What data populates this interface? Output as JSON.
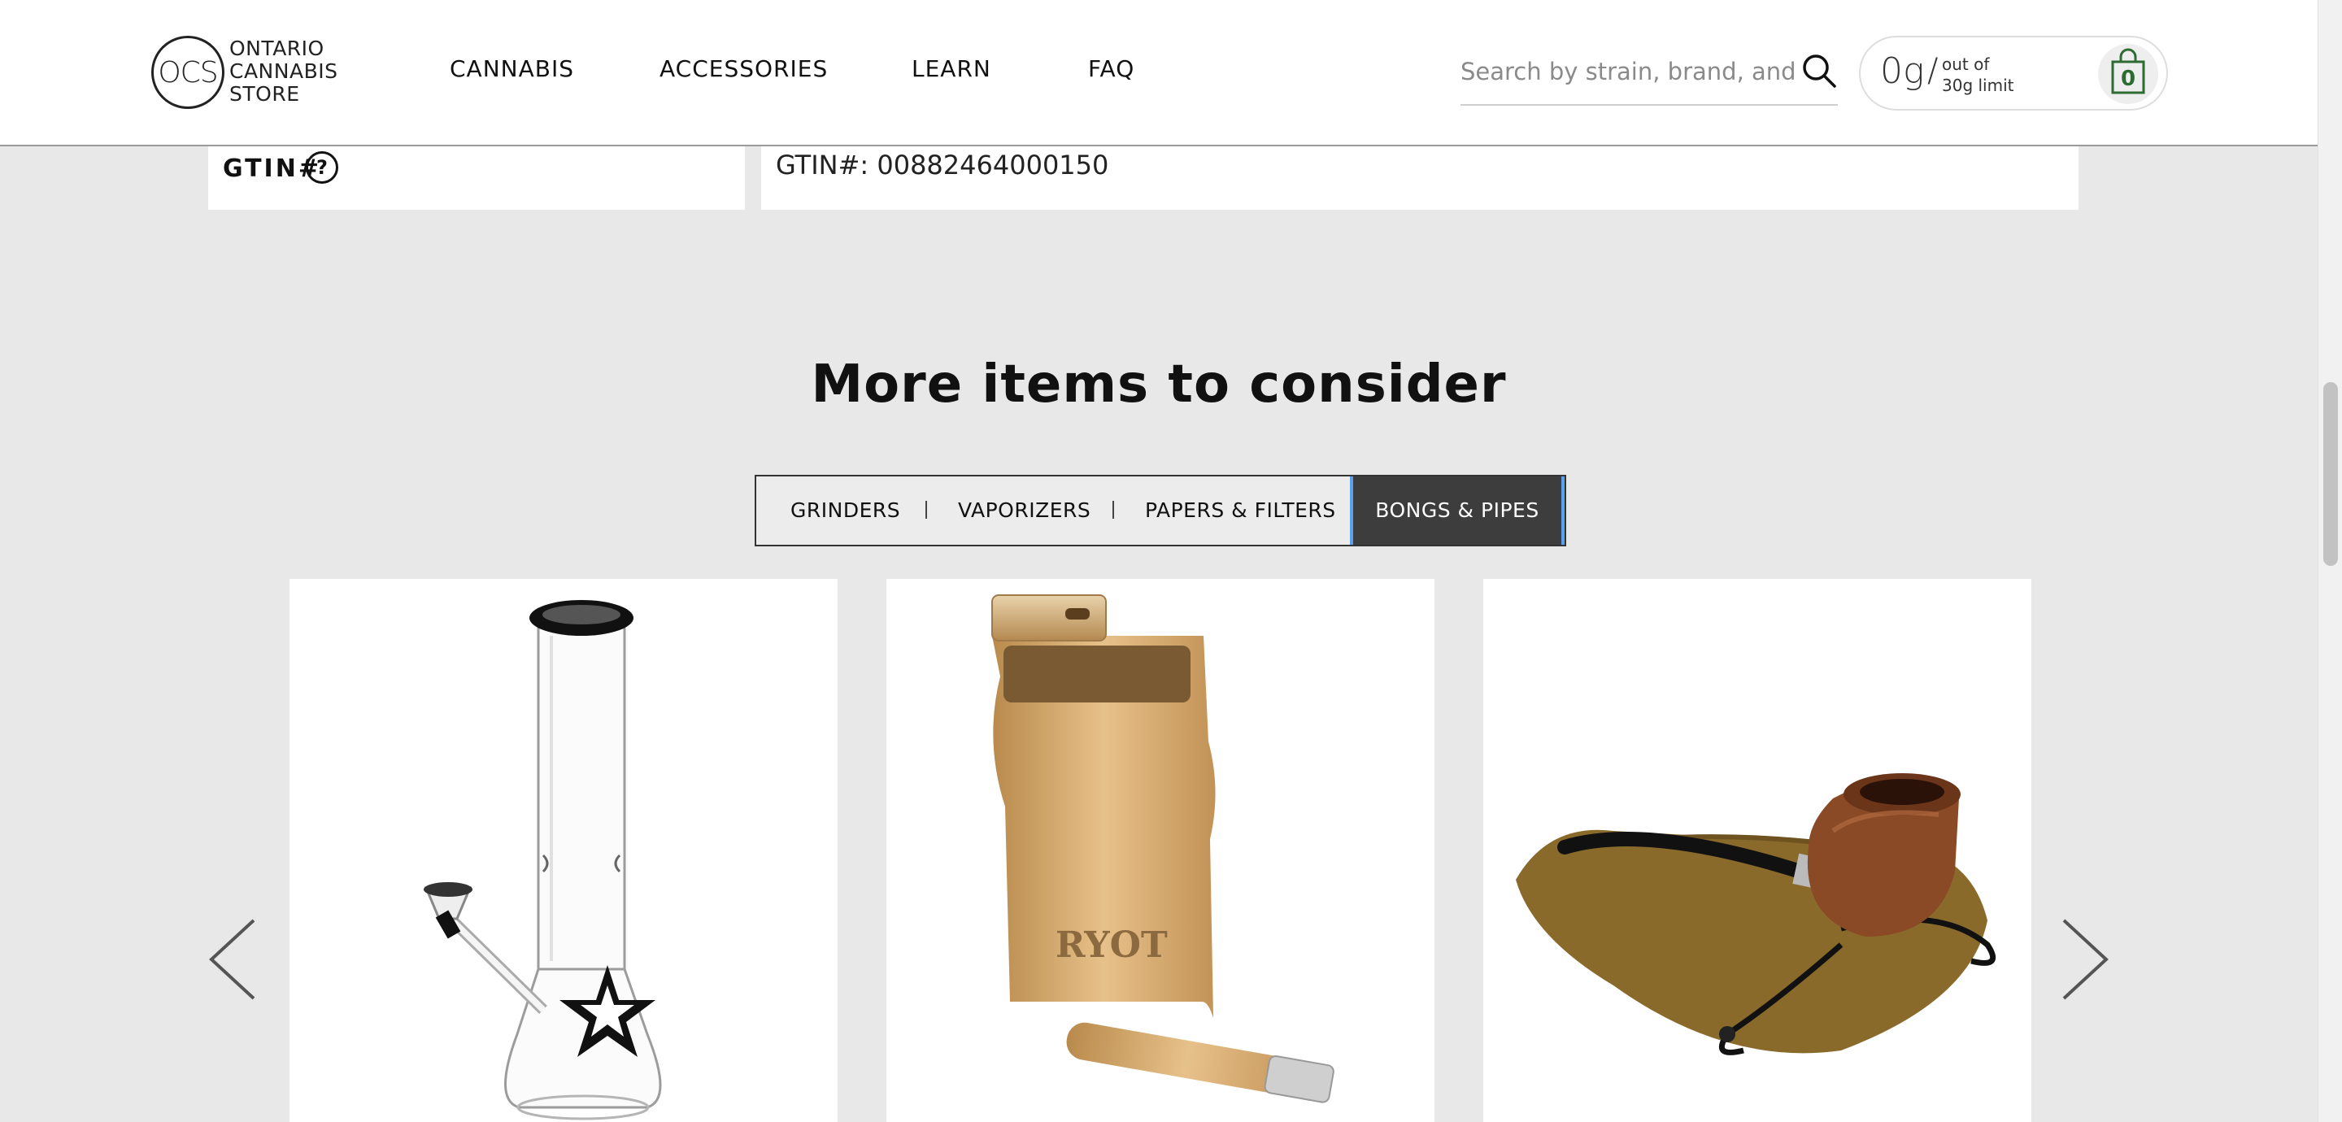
{
  "header": {
    "logo": {
      "mark": "OCS",
      "lines": [
        "ONTARIO",
        "CANNABIS",
        "STORE"
      ]
    },
    "nav": [
      "CANNABIS",
      "ACCESSORIES",
      "LEARN",
      "FAQ"
    ],
    "search": {
      "placeholder": "Search by strain, brand, and more",
      "value": ""
    },
    "limit": {
      "amount": "0g",
      "separator": "/",
      "text_line1": "out of",
      "text_line2": "30g limit"
    },
    "cart": {
      "count": "0"
    }
  },
  "gtin": {
    "label": "GTIN#",
    "help": "?",
    "value": "GTIN#: 00882464000150"
  },
  "more_items": {
    "title": "More items to consider",
    "tabs": [
      "GRINDERS",
      "VAPORIZERS",
      "PAPERS & FILTERS",
      "BONGS & PIPES"
    ],
    "active_tab": "BONGS & PIPES",
    "products": [
      {
        "image": "glass-beaker-bong-with-star"
      },
      {
        "image": "bamboo-dugout-with-one-hitter",
        "brand_mark": "RYOT"
      },
      {
        "image": "wooden-pipe-with-pouch"
      }
    ]
  },
  "colors": {
    "accent": "#5aa0ea",
    "active_tab": "#3d3d3d",
    "cart_count": "#2e6b33",
    "page_bg": "#e8e8e8"
  }
}
